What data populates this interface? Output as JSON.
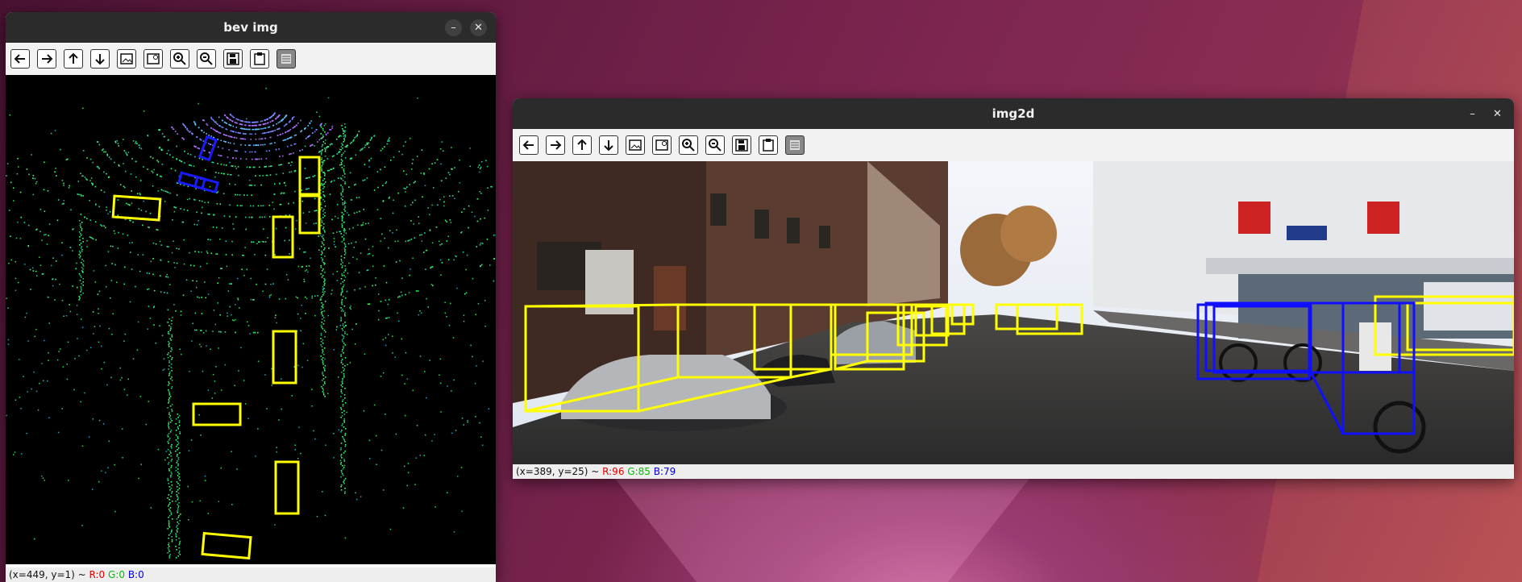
{
  "desktop": {
    "bg_primary": "#6c1f46",
    "bg_accent": "#c9669a"
  },
  "bev_window": {
    "title": "bev img",
    "minimize_icon": "–",
    "close_icon": "✕",
    "toolbar": [
      "pan-left",
      "pan-right",
      "pan-up",
      "pan-down",
      "zoom-in-image",
      "zoom-out-image",
      "zoom-in",
      "zoom-out",
      "save",
      "copy-clipboard",
      "properties"
    ],
    "status": {
      "coords": "(x=449, y=1) ~ ",
      "r": "R:0",
      "g": "G:0",
      "b": "B:0"
    }
  },
  "img2d_window": {
    "title": "img2d",
    "minimize_icon": "–",
    "close_icon": "✕",
    "toolbar": [
      "pan-left",
      "pan-right",
      "pan-up",
      "pan-down",
      "zoom-in-image",
      "zoom-out-image",
      "zoom-in",
      "zoom-out",
      "save",
      "copy-clipboard",
      "properties"
    ],
    "status": {
      "coords": "(x=389, y=25) ~ ",
      "r": "R:96",
      "g": "G:85",
      "b": "B:79"
    }
  },
  "colors": {
    "car_box": "#ffff00",
    "cyclist_box": "#0000ff",
    "lidar": "#44ff66"
  }
}
